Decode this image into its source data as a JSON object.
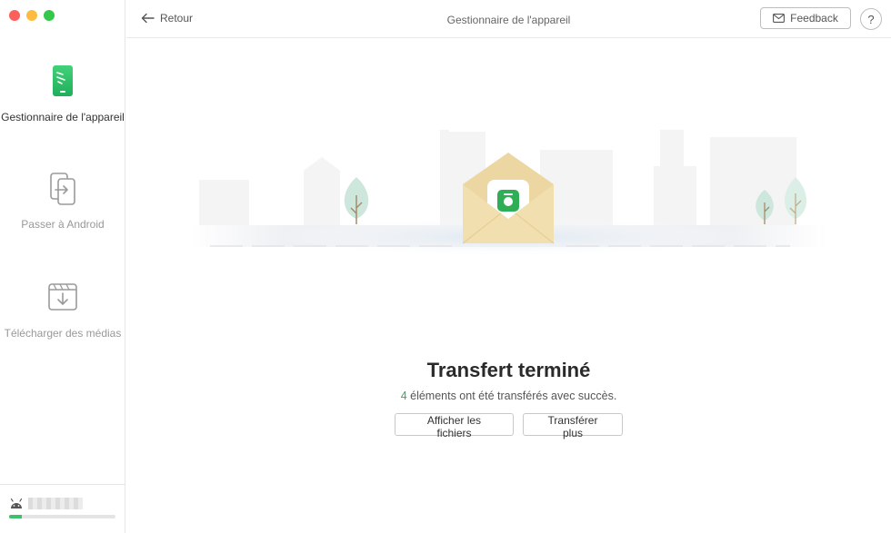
{
  "window": {
    "title": "Gestionnaire de l'appareil"
  },
  "sidebar": {
    "items": [
      {
        "label": "Gestionnaire de l'appareil",
        "icon": "phone-manager-icon",
        "active": true
      },
      {
        "label": "Passer à Android",
        "icon": "transfer-to-android-icon",
        "active": false
      },
      {
        "label": "Télécharger des médias",
        "icon": "download-media-icon",
        "active": false
      }
    ],
    "device": {
      "icon": "android-icon",
      "storage_used_fraction": 0.12
    }
  },
  "header": {
    "back_label": "Retour",
    "title": "Gestionnaire de l'appareil",
    "feedback_label": "Feedback",
    "help_label": "?"
  },
  "main": {
    "title": "Transfert terminé",
    "subtitle_count": "4",
    "subtitle_text": " éléments ont été transférés avec succès.",
    "buttons": {
      "show_files": "Afficher les fichiers",
      "transfer_more": "Transférer plus"
    }
  },
  "colors": {
    "accent_green": "#2fae55",
    "envelope": "#f1dfb0"
  }
}
